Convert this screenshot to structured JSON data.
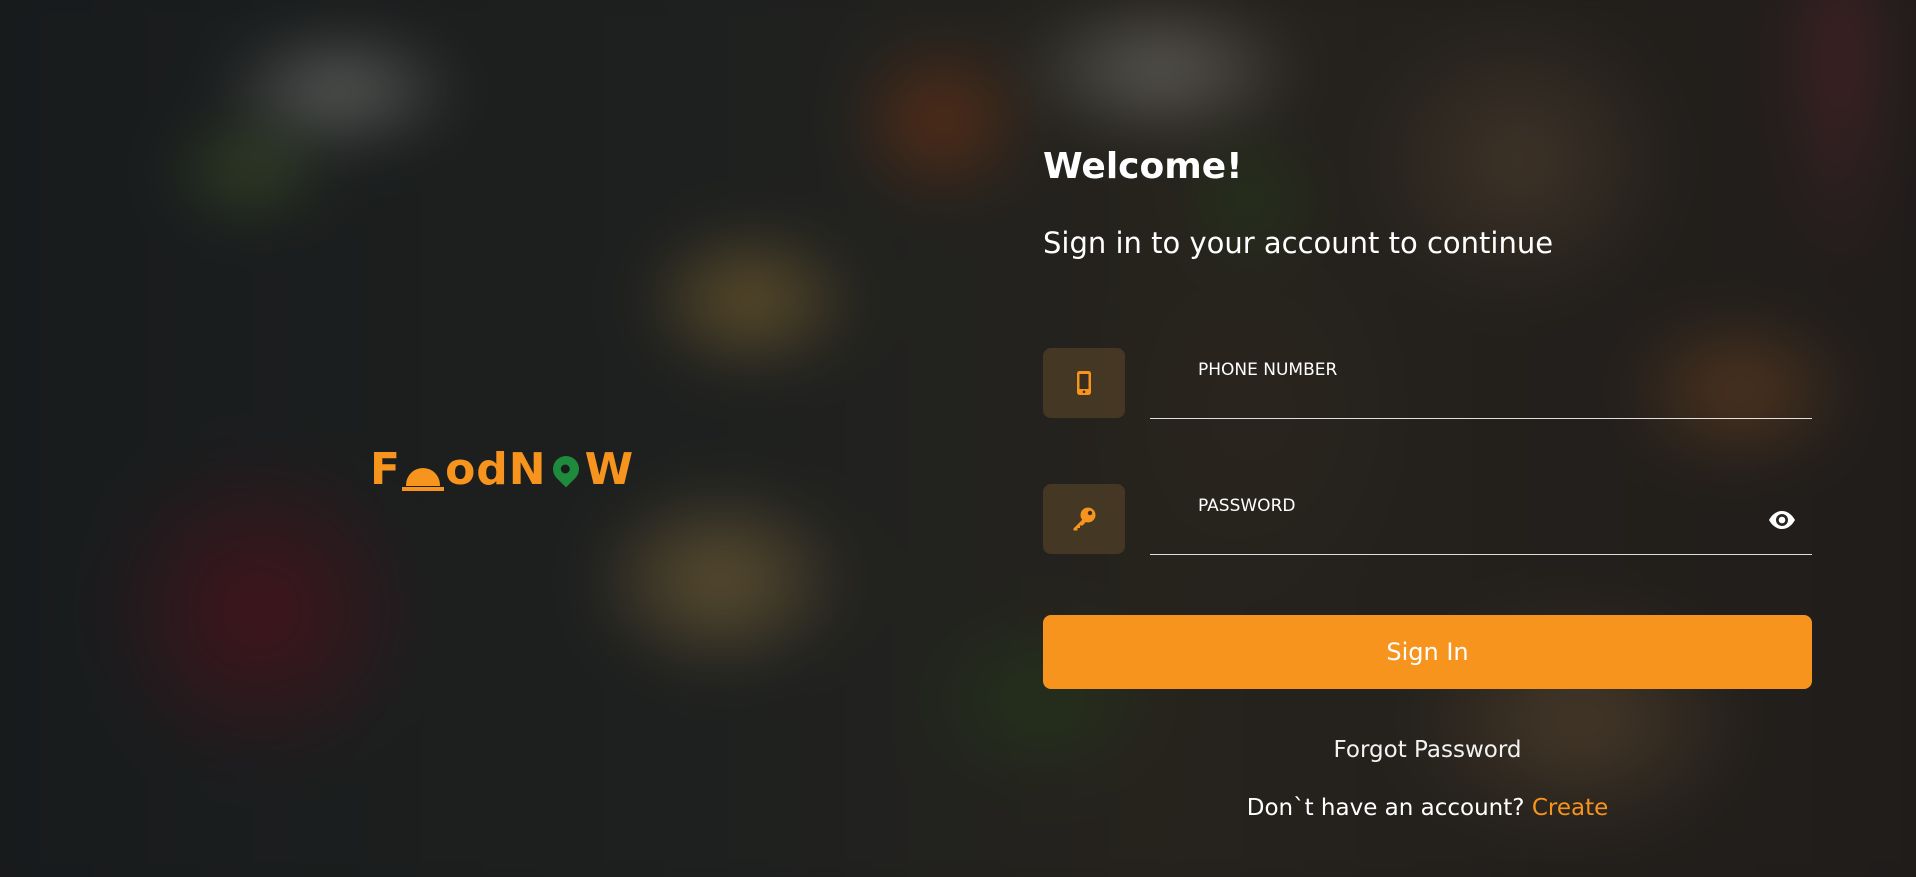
{
  "brand": {
    "logo_prefix": "F",
    "logo_middle": "odN",
    "logo_suffix": "W",
    "accent_color": "#f7941d",
    "pin_color": "#1e8a3c"
  },
  "form": {
    "title": "Welcome!",
    "subtitle": "Sign in to your account to continue",
    "phone": {
      "placeholder": "PHONE NUMBER",
      "icon": "mobile-phone-icon"
    },
    "password": {
      "placeholder": "PASSWORD",
      "icon": "key-icon",
      "toggle_icon": "eye-icon"
    },
    "submit_label": "Sign In",
    "forgot_label": "Forgot Password",
    "signup_prompt": "Don`t have an account? ",
    "signup_link": "Create"
  }
}
